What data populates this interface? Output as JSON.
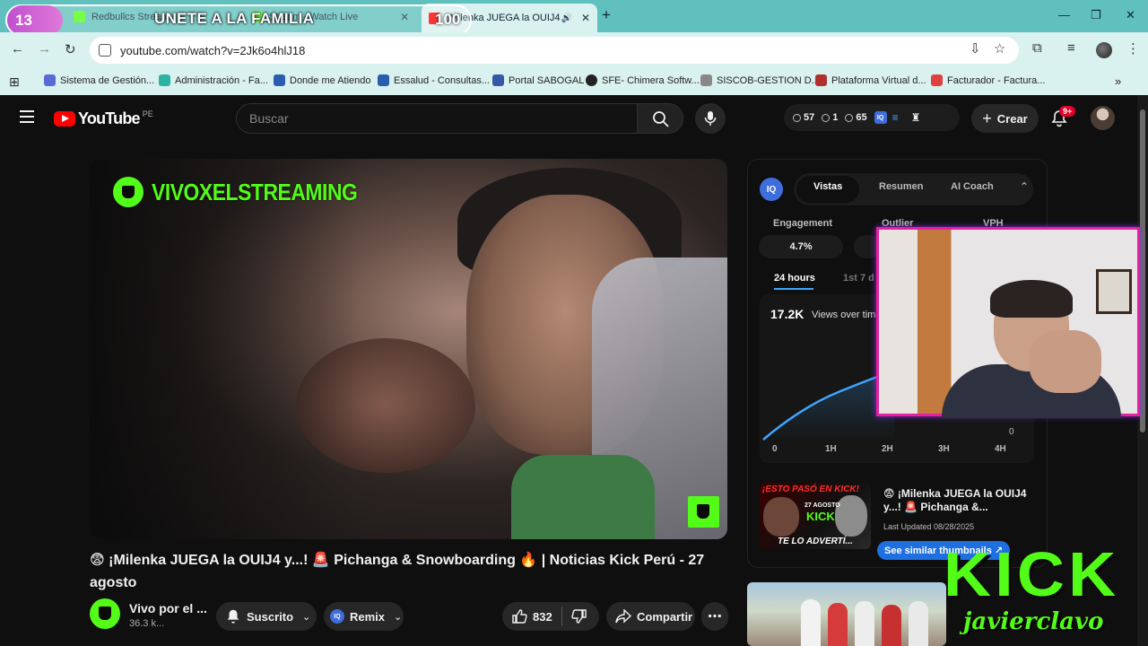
{
  "overlay": {
    "count": "13",
    "banner": "UNETE A LA FAMILIA",
    "goal": "100"
  },
  "tabs": [
    {
      "title": "Redbullcs Stream",
      "color": "#53fc18"
    },
    {
      "title": "Stream - Watch Live",
      "color": "#53fc18"
    },
    {
      "title": "¡Milenka JUEGA la OUIJ4",
      "color": "#ff0000"
    }
  ],
  "browser": {
    "url": "youtube.com/watch?v=2Jk6o4hlJ18"
  },
  "bookmarks": [
    {
      "label": "Sistema de Gestión...",
      "color": "#5b6bd6"
    },
    {
      "label": "Administración - Fa...",
      "color": "#2bb3a3"
    },
    {
      "label": "Donde me Atiendo",
      "color": "#2a5db0"
    },
    {
      "label": "Essalud - Consultas...",
      "color": "#2a5db0"
    },
    {
      "label": "Portal SABOGAL",
      "color": "#3559a8"
    },
    {
      "label": "SFE- Chimera Softw...",
      "color": "#222222"
    },
    {
      "label": "SISCOB-GESTION D...",
      "color": "#888888"
    },
    {
      "label": "Plataforma Virtual d...",
      "color": "#b03030"
    },
    {
      "label": "Facturador - Factura...",
      "color": "#e04040"
    }
  ],
  "youtube": {
    "logo": "YouTube",
    "country": "PE",
    "search_placeholder": "Buscar",
    "stats": {
      "a": "57",
      "b": "1",
      "c": "65"
    },
    "create_label": "Crear",
    "notif_badge": "9+"
  },
  "video": {
    "watermark": "VIVOXELSTREAMING",
    "title": "😨 ¡Milenka JUEGA la OUIJ4 y...! 🚨 Pichanga & Snowboarding 🔥 | Noticias Kick Perú - 27 agosto",
    "channel_name": "Vivo por el ...",
    "subscribers": "36.3 k...",
    "subscribed_label": "Suscrito",
    "remix_label": "Remix",
    "likes": "832",
    "share_label": "Compartir"
  },
  "panel": {
    "iq": "IQ",
    "tabs": [
      "Vistas",
      "Resumen",
      "AI Coach"
    ],
    "metrics": [
      {
        "label": "Engagement",
        "value": "4.7%"
      },
      {
        "label": "Outlier"
      },
      {
        "label": "VPH"
      }
    ],
    "subtabs": [
      "24 hours",
      "1st 7 d"
    ],
    "views_total": "17.2K",
    "views_caption": "Views over time",
    "x_ticks": [
      "0",
      "1H",
      "2H",
      "3H",
      "4H"
    ],
    "y_min": "0",
    "related": {
      "thumb_top": "¡ESTO PASÓ EN KICK!",
      "thumb_date": "27 AGOSTO",
      "thumb_kick": "KICK",
      "thumb_bottom": "TE LO ADVERTÍ...",
      "title": "😨 ¡Milenka JUEGA la OUIJ4 y...! 🚨 Pichanga &...",
      "meta": "Last Updated 08/28/2025",
      "similar_btn": "See similar thumbnails ↗"
    }
  },
  "stream": {
    "brand": "KICK",
    "streamer": "javierclavo"
  },
  "colors": {
    "kick_green": "#53fc18",
    "tab_bar": "#5fc0bd",
    "accent_blue": "#3ea6ff"
  }
}
